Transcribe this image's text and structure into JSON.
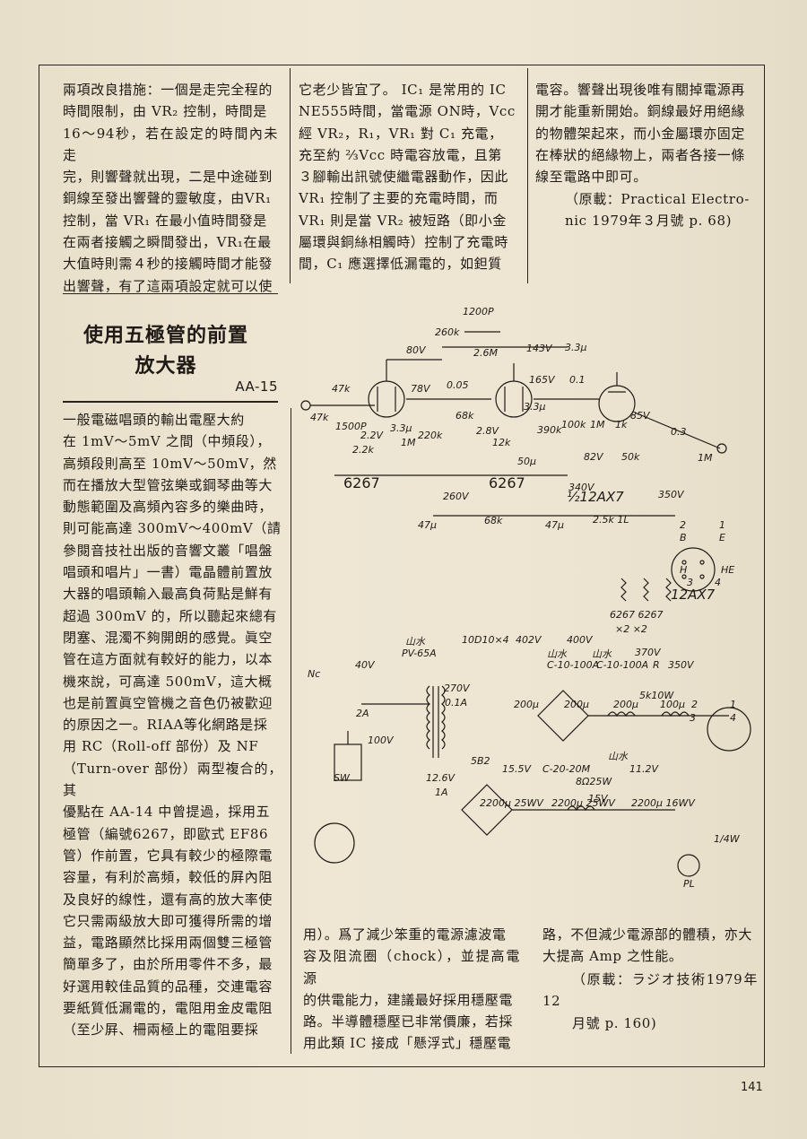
{
  "page_number": "141",
  "top": {
    "col1": [
      "兩項改良措施：一個是走完全程的",
      "時間限制，由 VR₂ 控制，時間是",
      "16～94秒，若在設定的時間內未走",
      "完，則響聲就出現，二是中途碰到",
      "銅線至發出響聲的靈敏度，由VR₁",
      "控制，當 VR₁ 在最小值時間發是",
      "在兩者接觸之瞬間發出，VR₁在最",
      "大值時則需４秒的接觸時間才能發",
      "出響聲，有了這兩項設定就可以使"
    ],
    "col2": [
      "它老少皆宜了。 IC₁ 是常用的 IC",
      "NE555時間，當電源 ON時，Vcc",
      "經 VR₂，R₁，VR₁ 對 C₁ 充電，",
      "充至約 ⅔Vcc 時電容放電，且第",
      "３腳輸出訊號使繼電器動作，因此",
      "VR₁ 控制了主要的充電時間，而",
      "VR₁ 則是當 VR₂ 被短路（即小金",
      "屬環與銅絲相觸時）控制了充電時",
      "間，C₁ 應選擇低漏電的，如鉭質"
    ],
    "col3": [
      "電容。響聲出現後唯有關掉電源再",
      "開才能重新開始。銅線最好用絕緣",
      "的物體架起來，而小金屬環亦固定",
      "在棒狀的絕緣物上，兩者各接一條",
      "線至電路中即可。"
    ],
    "col3_source": [
      "（原載：Practical Electro-",
      "nic 1979年３月號 p. 68)"
    ]
  },
  "article": {
    "title_line1": "使用五極管的前置",
    "title_line2": "放大器",
    "code": "AA-15",
    "left_col": [
      "一般電磁唱頭的輸出電壓大約",
      "在 1mV～5mV 之間（中頻段），",
      "高頻段則高至 10mV～50mV，然",
      "而在播放大型管弦樂或鋼琴曲等大",
      "動態範圍及高頻內容多的樂曲時，",
      "則可能高達 300mV～400mV（請",
      "參閱音技社出版的音響文叢「唱盤",
      "唱頭和唱片」一書）電晶體前置放",
      "大器的唱頭輸入最高負荷點是鮮有",
      "超過 300mV 的，所以聽起來總有",
      "閉塞、混濁不夠開朗的感覺。眞空",
      "管在這方面就有較好的能力，以本",
      "機來說，可高達 500mV，這大概",
      "也是前置眞空管機之音色仍被歡迎",
      "的原因之一。RIAA等化網路是採",
      "用 RC（Roll-off 部份）及 NF",
      "（Turn-over 部份）兩型複合的，其",
      "優點在 AA-14 中曾提過，採用五",
      "極管（編號6267，即歐式 EF86",
      "管）作前置，它具有較少的極際電",
      "容量，有利於高頻，較低的屛內阻",
      "及良好的線性，還有高的放大率使",
      "它只需兩級放大即可獲得所需的增",
      "益，電路顯然比採用兩個雙三極管",
      "簡單多了，由於所用零件不多，最",
      "好選用較佳品質的品種，交連電容",
      "要紙質低漏電的，電阻用金皮電阻",
      "（至少屛、柵兩極上的電阻要採"
    ],
    "mid_col": [
      "用）。爲了減少笨重的電源濾波電",
      "容及阻流圈（chock），並提高電源",
      "的供電能力，建議最好採用穩壓電",
      "路。半導體穩壓已非常價廉，若採",
      "用此類 IC 接成「懸浮式」穩壓電"
    ],
    "right_col": [
      "路，不但減少電源部的體積，亦大",
      "大提高 Amp 之性能。"
    ],
    "right_source": [
      "（原載：ラジオ技術1979年12",
      "月號 p. 160)"
    ]
  },
  "schematic": {
    "tube1": "6267",
    "tube2": "6267",
    "tube3": "½12AX7",
    "heater_tube": "12AX7",
    "heater_note": "6267 6267",
    "heater_mult": "×2   ×2",
    "pin_B": "B",
    "pin_E": "E",
    "pin_H": "H",
    "pin_HE": "HE",
    "pin_2": "2",
    "pin_3": "3",
    "pin_4": "4",
    "pin_1": "1",
    "labels": {
      "c1200p": "1200P",
      "r260k": "260k",
      "r2m6": "2.6M",
      "v80": "80V",
      "v143": "143V",
      "c33u": "3.3μ",
      "r47k": "47k",
      "v78": "78V",
      "c005": "0.05",
      "v165": "165V",
      "c01": "0.1",
      "r47k_v": "47k",
      "c1500p": "1500P",
      "v22": "2.2V",
      "c33u_b": "3.3μ",
      "r22k": "2.2k",
      "r1m_a": "1M",
      "r220k": "220k",
      "r68k_a": "68k",
      "v28": "2.8V",
      "c33u_c": "3.3μ",
      "r390k": "390k",
      "r100k": "100k",
      "r12k": "12k",
      "c50u": "50μ",
      "r1m_b": "1M",
      "r1k": "1k",
      "v85": "85V",
      "v82": "82V",
      "r50k": "50k",
      "c03": "0.3",
      "r1m_c": "1M",
      "v260": "260V",
      "c47u_a": "47μ",
      "r68k_b": "68k",
      "c47u_b": "47μ",
      "v340": "340V",
      "r25k": "2.5k 1L",
      "v350": "350V",
      "brand1": "山水",
      "pv65a": "PV-65A",
      "d10d10": "10D10×4",
      "v402": "402V",
      "v400": "400V",
      "v370": "370V",
      "ch1": "山水",
      "ch1b": "C-10-100A",
      "ch2": "山水",
      "ch2b": "C-10-100A",
      "r_r": "R",
      "v350b": "350V",
      "nc": "Nc",
      "v40": "40V",
      "v270": "270V",
      "a01": "0.1A",
      "r5k": "5k10W",
      "c200u_a": "200μ",
      "c200u_b": "200μ",
      "c200u_c": "200μ",
      "c100u": "100μ",
      "fuse": "2A",
      "v100": "100V",
      "sw": "SW",
      "t5b2": "5B2",
      "ch3": "山水",
      "ch3b": "C-20-20M",
      "v126": "12.6V",
      "a1": "1A",
      "v155": "15.5V",
      "r825w": "8Ω25W",
      "v112": "11.2V",
      "c2200a": "2200μ 25WV",
      "c2200b": "2200μ 25WV",
      "c2200c": "2200μ 16WV",
      "v15": "15V",
      "r1_4w": "1/4W",
      "pl": "PL"
    }
  }
}
